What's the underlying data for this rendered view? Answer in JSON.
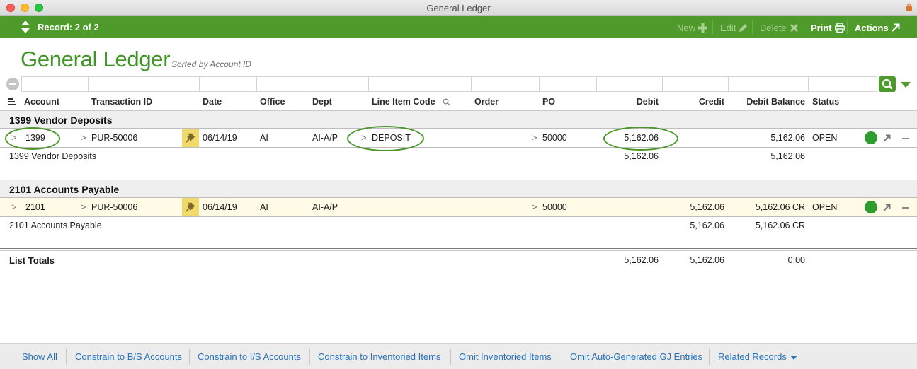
{
  "window": {
    "title": "General Ledger"
  },
  "toolbar": {
    "record_label": "Record: 2 of 2",
    "new_label": "New",
    "edit_label": "Edit",
    "delete_label": "Delete",
    "print_label": "Print",
    "actions_label": "Actions"
  },
  "page": {
    "title": "General Ledger",
    "subtitle": "Sorted by Account ID"
  },
  "columns": [
    "Account",
    "Transaction ID",
    "Date",
    "Office",
    "Dept",
    "Line Item Code",
    "Order",
    "PO",
    "Debit",
    "Credit",
    "Debit Balance",
    "Status"
  ],
  "groups": [
    {
      "title": "1399 Vendor Deposits",
      "row": {
        "account": "1399",
        "transaction_id": "PUR-50006",
        "date": "06/14/19",
        "office": "AI",
        "dept": "AI-A/P",
        "line_item_code": "DEPOSIT",
        "order": "",
        "po": "50000",
        "debit": "5,162.06",
        "credit": "",
        "debit_balance": "5,162.06",
        "status": "OPEN",
        "status_color": "#2e9d2e"
      },
      "subtotal": {
        "label": "1399 Vendor Deposits",
        "debit": "5,162.06",
        "credit": "",
        "debit_balance": "5,162.06"
      }
    },
    {
      "title": "2101 Accounts Payable",
      "row": {
        "account": "2101",
        "transaction_id": "PUR-50006",
        "date": "06/14/19",
        "office": "AI",
        "dept": "AI-A/P",
        "line_item_code": "",
        "order": "",
        "po": "50000",
        "debit": "",
        "credit": "5,162.06",
        "debit_balance": "5,162.06 CR",
        "status": "OPEN",
        "status_color": "#2e9d2e"
      },
      "subtotal": {
        "label": "2101 Accounts Payable",
        "debit": "",
        "credit": "5,162.06",
        "debit_balance": "5,162.06 CR"
      }
    }
  ],
  "totals": {
    "label": "List Totals",
    "debit": "5,162.06",
    "credit": "5,162.06",
    "debit_balance": "0.00"
  },
  "footer": {
    "links": [
      "Show All",
      "Constrain to B/S Accounts",
      "Constrain to I/S Accounts",
      "Constrain to Inventoried Items",
      "Omit Inventoried Items",
      "Omit Auto-Generated GJ Entries",
      "Related Records"
    ]
  },
  "colors": {
    "brand_green": "#4e9a2a",
    "title_green": "#3f9425",
    "link_blue": "#2a73b8",
    "highlight_yellow": "#fffbe6"
  }
}
